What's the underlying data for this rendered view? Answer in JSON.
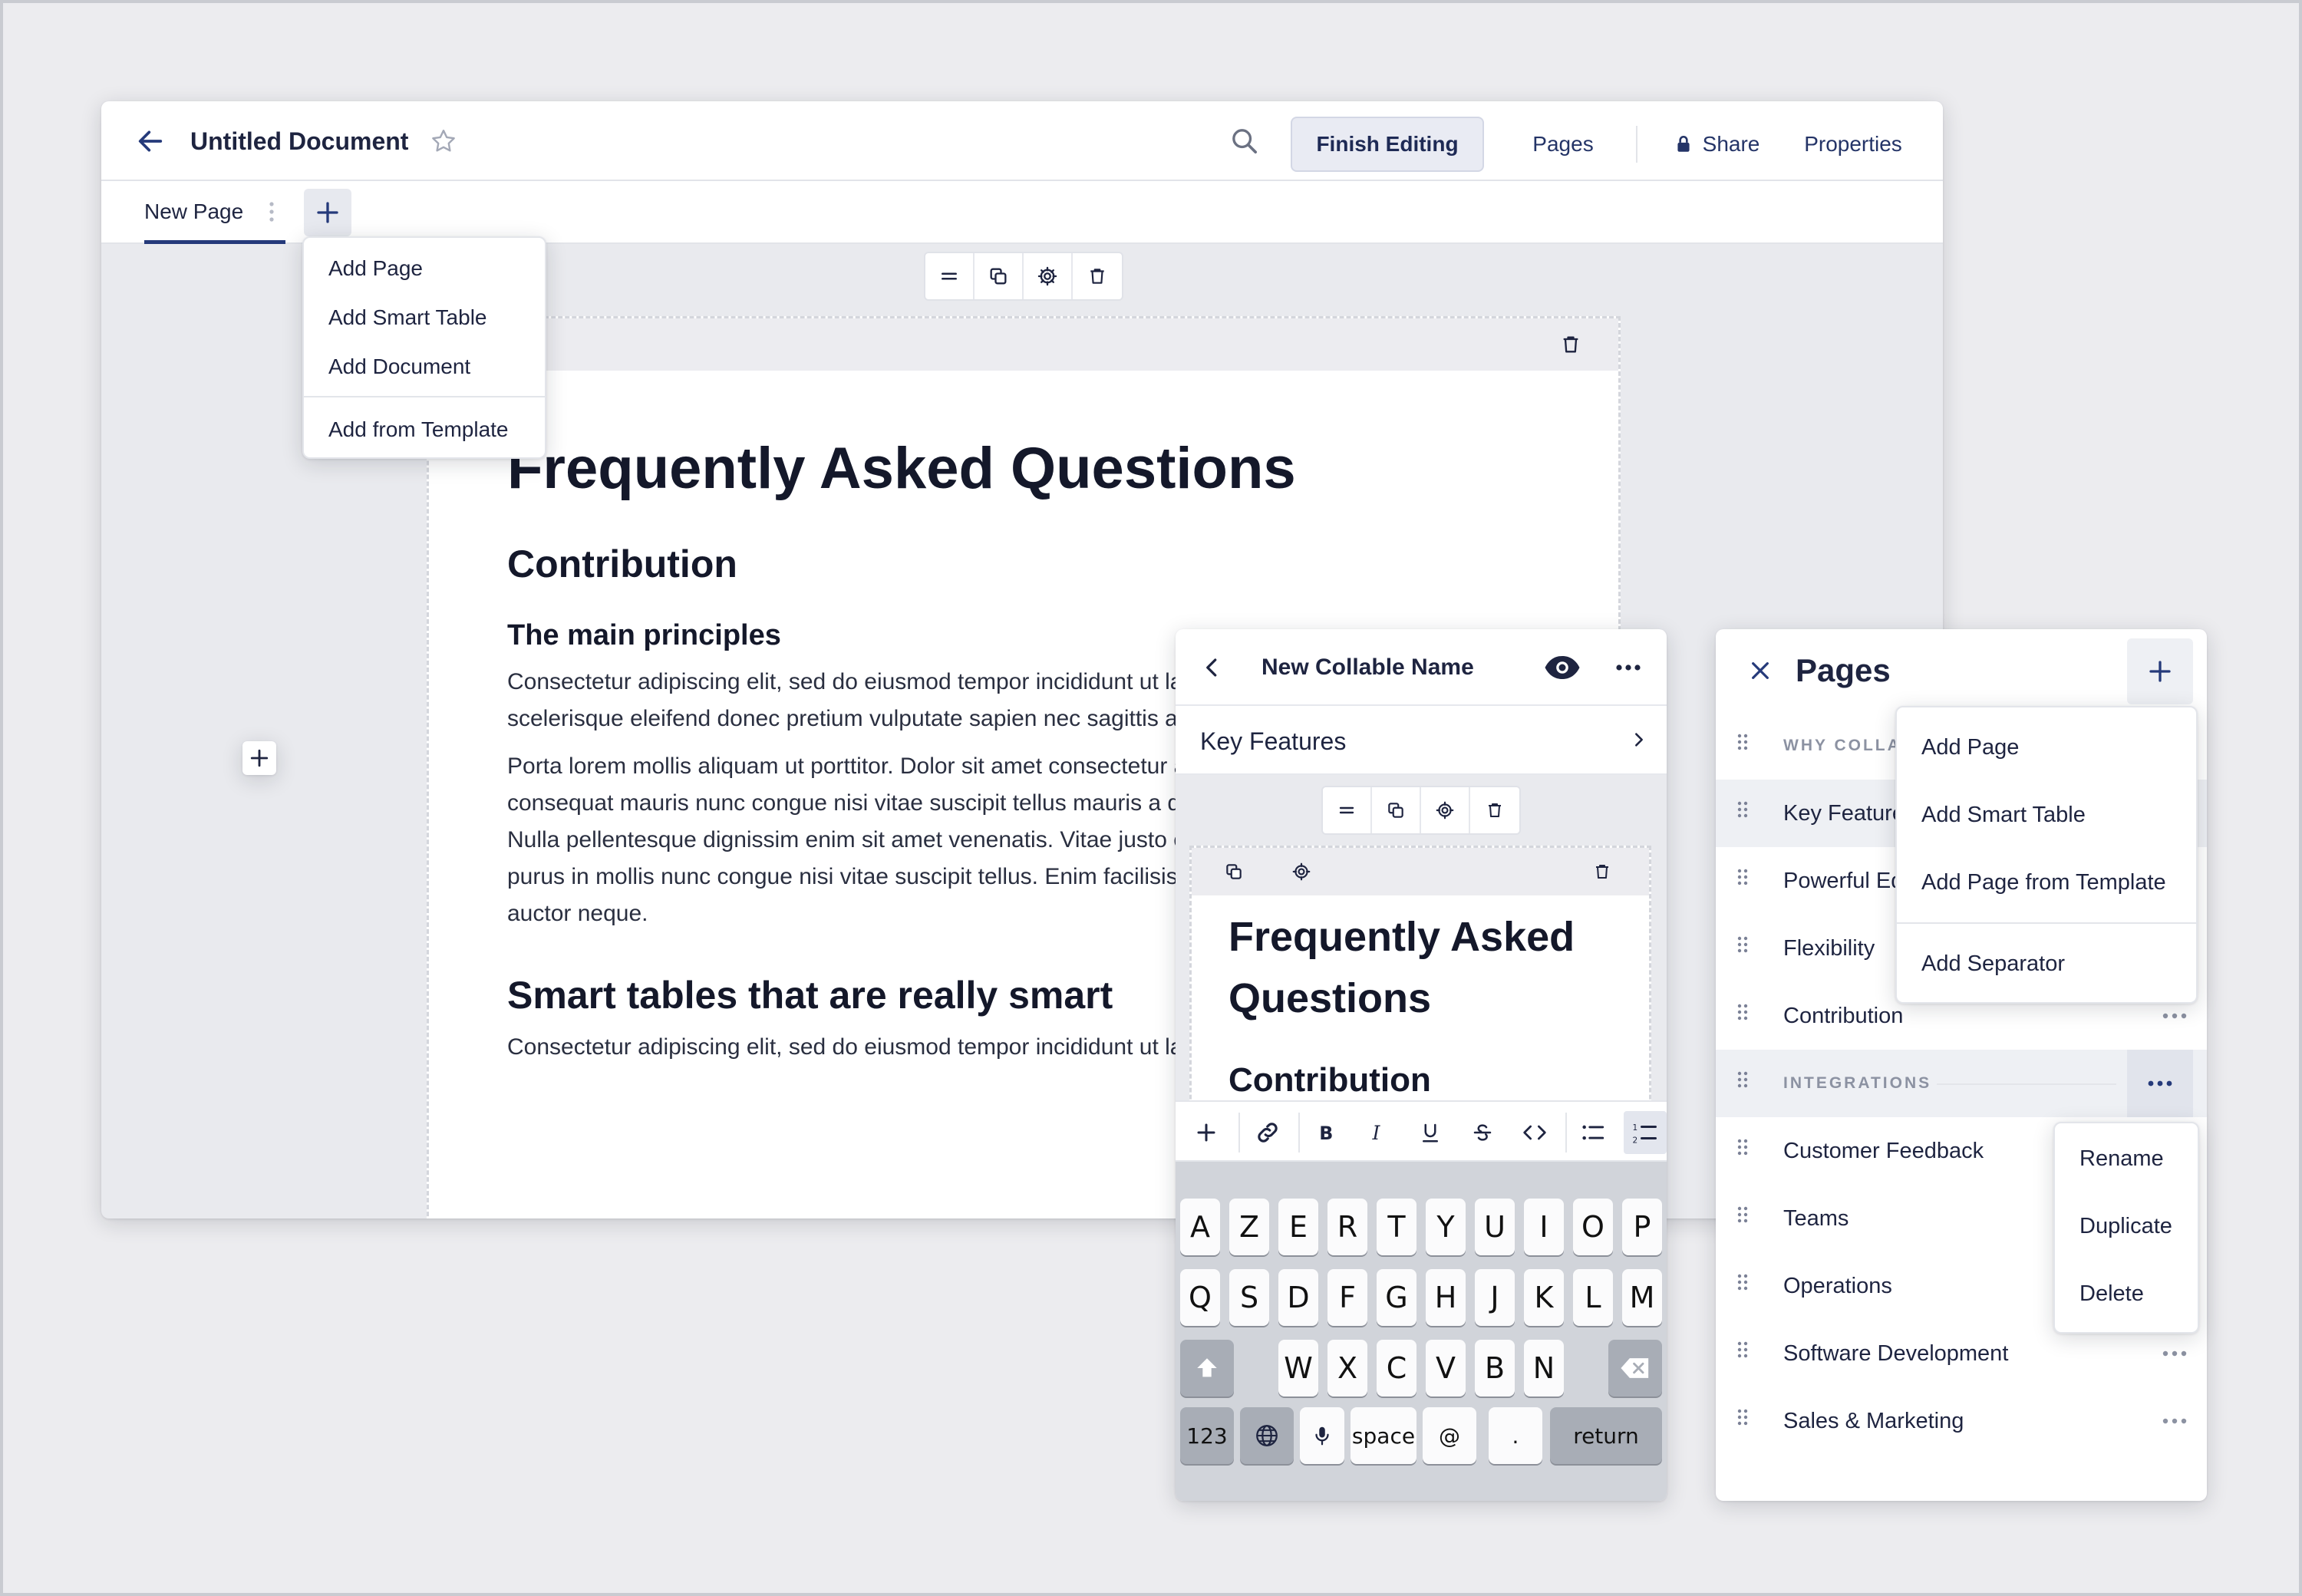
{
  "main": {
    "title": "Untitled Document",
    "finish_editing": "Finish Editing",
    "pages": "Pages",
    "share": "Share",
    "properties": "Properties",
    "tab_label": "New Page",
    "add_menu": {
      "items": [
        "Add Page",
        "Add Smart Table",
        "Add Document"
      ],
      "template": "Add from Template"
    },
    "document": {
      "h1": "Frequently Asked Questions",
      "h2": "Contribution",
      "h3": "The main principles",
      "p1": "Consectetur adipiscing elit, sed do eiusmod tempor incididunt ut labore et dolore magna aliqua. Faucibus scelerisque eleifend donec pretium vulputate sapien nec sagittis aliquam neque volutpat ac tincidunt.",
      "p2": "Porta lorem mollis aliquam ut porttitor. Dolor sit amet consectetur adipiscing elit duis aliquam. Volutpat consequat mauris nunc congue nisi vitae suscipit tellus mauris a diam mattis pellentesque id nibh tortor id. Nulla pellentesque dignissim enim sit amet venenatis. Vitae justo eget magna fermentum iaculis. Amet nisl purus in mollis nunc congue nisi vitae suscipit tellus. Enim facilisis gravida neque convallis a cras semper auctor neque.",
      "h2b": "Smart tables that are really smart",
      "p3": "Consectetur adipiscing elit, sed do eiusmod tempor incididunt ut labore"
    }
  },
  "mobile": {
    "title": "New Collable Name",
    "subnav": "Key Features",
    "h1": "Frequently Asked Questions",
    "h2": "Contribution",
    "keyboard": {
      "row1": [
        "A",
        "Z",
        "E",
        "R",
        "T",
        "Y",
        "U",
        "I",
        "O",
        "P"
      ],
      "row2": [
        "Q",
        "S",
        "D",
        "F",
        "G",
        "H",
        "J",
        "K",
        "L",
        "M"
      ],
      "row3": [
        "W",
        "X",
        "C",
        "V",
        "B",
        "N"
      ],
      "num": "123",
      "space": "space",
      "at": "@",
      "dot": ".",
      "return": "return"
    }
  },
  "pages_panel": {
    "title": "Pages",
    "sections": [
      "WHY COLLABLE",
      "INTEGRATIONS"
    ],
    "items_top": [
      "Key Features",
      "Powerful Editor",
      "Flexibility",
      "Contribution"
    ],
    "items_bottom": [
      "Customer Feedback",
      "Teams",
      "Operations",
      "Software Development",
      "Sales & Marketing"
    ],
    "add_menu": [
      "Add Page",
      "Add Smart Table",
      "Add Page from Template"
    ],
    "add_separator": "Add Separator",
    "context_menu": [
      "Rename",
      "Duplicate",
      "Delete"
    ]
  }
}
